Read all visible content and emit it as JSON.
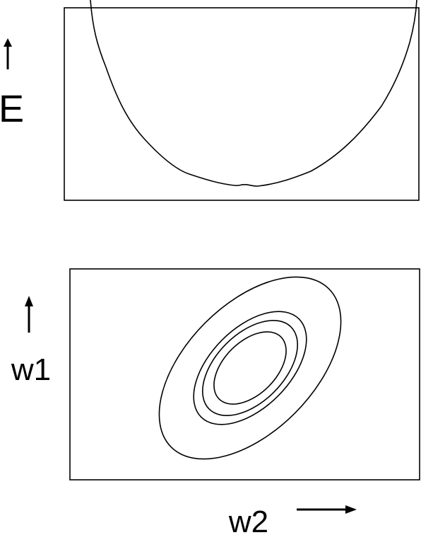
{
  "energy_panel": {
    "axis_label": "E"
  },
  "contour_panel": {
    "vertical_axis_label": "w1",
    "horizontal_axis_label": "w2",
    "contour_count": 4
  },
  "colors": {
    "ink": "#000000",
    "background": "#ffffff"
  },
  "icons": {
    "up_arrow": "up-arrow-icon",
    "right_arrow": "right-arrow-icon"
  }
}
